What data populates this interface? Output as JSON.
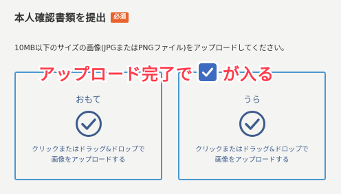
{
  "section": {
    "title": "本人確認書類を提出",
    "required_badge": "必須",
    "description": "10MB以下のサイズの画像(JPGまたはPNGファイル)をアップロードしてください。"
  },
  "upload_cards": [
    {
      "label": "おもて",
      "icon": "check-circle-icon",
      "instruction_line1": "クリックまたはドラッグ&ドロップで",
      "instruction_line2": "画像をアップロードする"
    },
    {
      "label": "うら",
      "icon": "check-circle-icon",
      "instruction_line1": "クリックまたはドラッグ&ドロップで",
      "instruction_line2": "画像をアップロードする"
    }
  ],
  "annotation": {
    "text_before": "アップロード完了で",
    "icon": "checkbox-checked-icon",
    "text_after": "が入る"
  },
  "colors": {
    "accent": "#4a97d1",
    "label": "#3e5c8b",
    "badge": "#e8622d",
    "annotation": "#ff3a4a",
    "check_icon": "#3d6bc0"
  }
}
